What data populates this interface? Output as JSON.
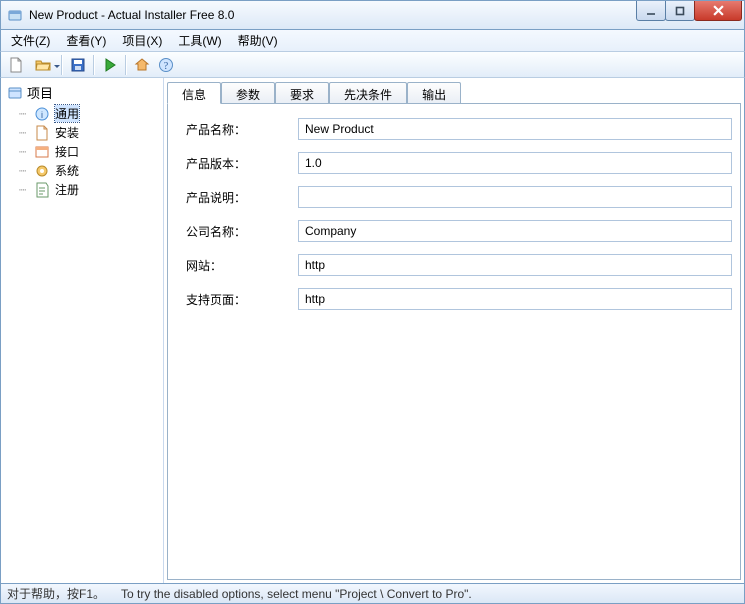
{
  "window": {
    "title": "New Product - Actual Installer Free 8.0"
  },
  "menu": {
    "file": "文件(Z)",
    "view": "查看(Y)",
    "project": "项目(X)",
    "tools": "工具(W)",
    "help": "帮助(V)"
  },
  "sidebar": {
    "title": "项目",
    "items": [
      {
        "label": "通用"
      },
      {
        "label": "安装"
      },
      {
        "label": "接口"
      },
      {
        "label": "系统"
      },
      {
        "label": "注册"
      }
    ]
  },
  "tabs": [
    {
      "label": "信息",
      "active": true
    },
    {
      "label": "参数"
    },
    {
      "label": "要求"
    },
    {
      "label": "先决条件"
    },
    {
      "label": "输出"
    }
  ],
  "form": {
    "product_name_label": "产品名称：",
    "product_name_value": "New Product",
    "product_version_label": "产品版本：",
    "product_version_value": "1.0",
    "product_desc_label": "产品说明：",
    "product_desc_value": "",
    "company_label": "公司名称：",
    "company_value": "Company",
    "website_label": "网站：",
    "website_value": "http",
    "support_label": "支持页面：",
    "support_value": "http"
  },
  "statusbar": {
    "help": "对于帮助，按F1。",
    "note": "To try the disabled options, select menu \"Project \\ Convert to Pro\"."
  }
}
